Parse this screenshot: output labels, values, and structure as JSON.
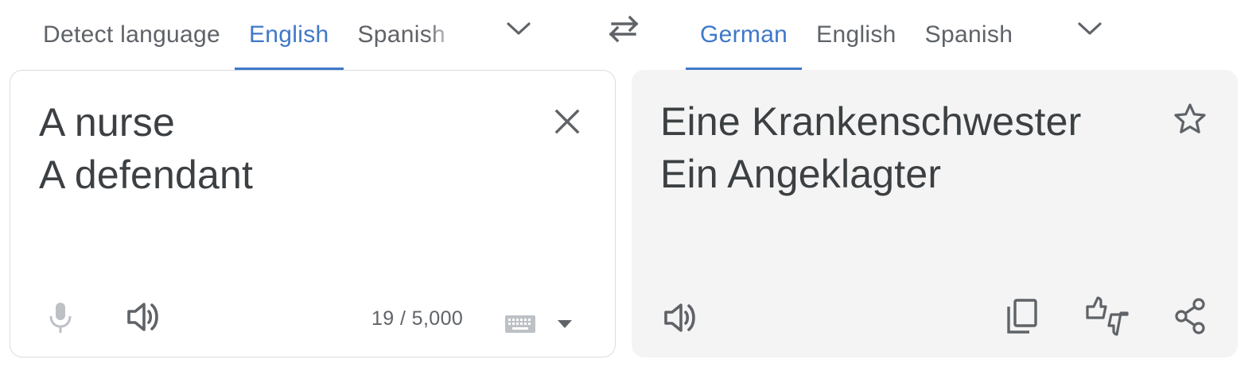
{
  "source_languages": {
    "tabs": [
      {
        "label": "Detect language",
        "active": false
      },
      {
        "label": "English",
        "active": true
      },
      {
        "label": "Spanish",
        "active": false
      }
    ],
    "more_icon": "chevron-down-icon"
  },
  "swap_icon": "swap-arrows-icon",
  "target_languages": {
    "tabs": [
      {
        "label": "German",
        "active": true
      },
      {
        "label": "English",
        "active": false
      },
      {
        "label": "Spanish",
        "active": false
      }
    ],
    "more_icon": "chevron-down-icon"
  },
  "source_panel": {
    "text": "A nurse\nA defendant",
    "char_count": "19 / 5,000",
    "icons": [
      "close-icon",
      "microphone-icon",
      "speaker-icon",
      "keyboard-icon",
      "dropdown-arrow-icon"
    ]
  },
  "target_panel": {
    "text": "Eine Krankenschwester\nEin Angeklagter",
    "icons": [
      "star-icon",
      "speaker-icon",
      "copy-icon",
      "feedback-icon",
      "share-icon"
    ]
  },
  "colors": {
    "accent": "#3f78c9",
    "text": "#3c4043",
    "muted": "#5f6368",
    "target_bg": "#f4f4f4",
    "border": "#dadce0"
  }
}
